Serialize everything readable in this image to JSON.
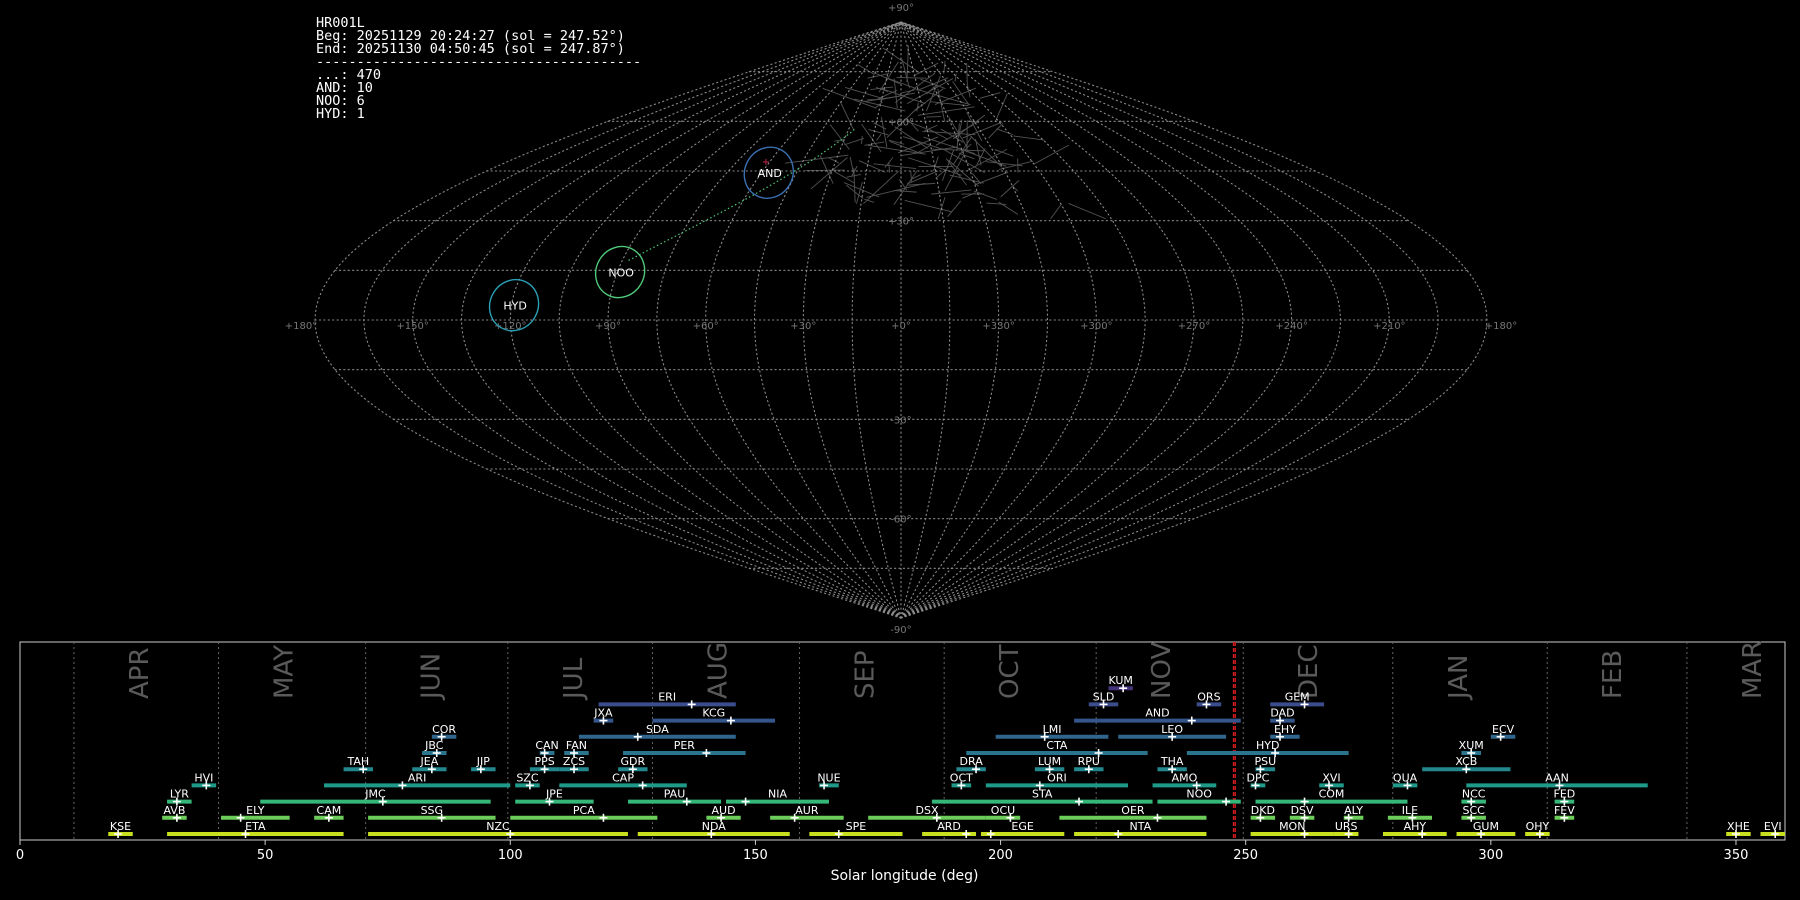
{
  "header": {
    "station": "HR001L",
    "beg": "Beg: 20251129 20:24:27 (sol = 247.52°)",
    "end": "End: 20251130 04:50:45 (sol = 247.87°)",
    "separator": "----------------------------------------",
    "counts": [
      {
        "label": "...: 470"
      },
      {
        "label": "AND: 10"
      },
      {
        "label": "NOO: 6"
      },
      {
        "label": "HYD: 1"
      }
    ]
  },
  "sky_map": {
    "projection": "sinusoidal",
    "lon_labels": [
      "+180°",
      "+150°",
      "+120°",
      "+90°",
      "+60°",
      "+30°",
      "+0°",
      "+330°",
      "+300°",
      "+270°",
      "+240°",
      "+210°",
      "+180°"
    ],
    "lat_labels": [
      "+90°",
      "+60°",
      "+30°",
      "-30°",
      "-60°",
      "-90°"
    ],
    "radiants": [
      {
        "code": "AND",
        "lon": 57,
        "lat": 45,
        "color": "#3b6fb0",
        "r": 6
      },
      {
        "code": "NOO",
        "lon": 89,
        "lat": 15,
        "color": "#4fc97a",
        "r": 6
      },
      {
        "code": "HYD",
        "lon": 119,
        "lat": 5,
        "color": "#2a9fb5",
        "r": 6
      }
    ]
  },
  "chart_data": {
    "type": "timeline",
    "xlabel": "Solar longitude (deg)",
    "xlim": [
      0,
      360
    ],
    "xticks": [
      0,
      50,
      100,
      150,
      200,
      250,
      300,
      350
    ],
    "current_sol": [
      247.52,
      247.87
    ],
    "months": [
      {
        "name": "APR",
        "start": 11
      },
      {
        "name": "MAY",
        "start": 40.5
      },
      {
        "name": "JUN",
        "start": 70.5
      },
      {
        "name": "JUL",
        "start": 99.5
      },
      {
        "name": "AUG",
        "start": 129
      },
      {
        "name": "SEP",
        "start": 159
      },
      {
        "name": "OCT",
        "start": 188.5
      },
      {
        "name": "NOV",
        "start": 219.5
      },
      {
        "name": "DEC",
        "start": 249.5
      },
      {
        "name": "JAN",
        "start": 280
      },
      {
        "name": "FEB",
        "start": 311.5
      },
      {
        "name": "MAR",
        "start": 340
      }
    ],
    "showers": [
      {
        "code": "KUM",
        "row": 8,
        "start": 222,
        "end": 227,
        "peak": 225,
        "color": "#44337a"
      },
      {
        "code": "ERI",
        "row": 7,
        "start": 118,
        "end": 146,
        "peak": 137,
        "color": "#3b4d8c"
      },
      {
        "code": "SLD",
        "row": 7,
        "start": 218,
        "end": 224,
        "peak": 221,
        "color": "#3b4d8c"
      },
      {
        "code": "ORS",
        "row": 7,
        "start": 240,
        "end": 245,
        "peak": 242,
        "color": "#3b4d8c"
      },
      {
        "code": "GEM",
        "row": 7,
        "start": 255,
        "end": 266,
        "peak": 262,
        "color": "#3b4d8c"
      },
      {
        "code": "JXA",
        "row": 6,
        "start": 117,
        "end": 121,
        "peak": 119,
        "color": "#34568c"
      },
      {
        "code": "KCG",
        "row": 6,
        "start": 129,
        "end": 154,
        "peak": 145,
        "color": "#34568c"
      },
      {
        "code": "AND",
        "row": 6,
        "start": 215,
        "end": 249,
        "peak": 239,
        "color": "#34568c"
      },
      {
        "code": "DAD",
        "row": 6,
        "start": 255,
        "end": 260,
        "peak": 257,
        "color": "#34568c"
      },
      {
        "code": "COR",
        "row": 5,
        "start": 84,
        "end": 89,
        "peak": 86,
        "color": "#30658c"
      },
      {
        "code": "SDA",
        "row": 5,
        "start": 114,
        "end": 146,
        "peak": 126,
        "color": "#30658c"
      },
      {
        "code": "LMI",
        "row": 5,
        "start": 199,
        "end": 222,
        "peak": 209,
        "color": "#30658c"
      },
      {
        "code": "LEO",
        "row": 5,
        "start": 224,
        "end": 246,
        "peak": 235,
        "color": "#30658c"
      },
      {
        "code": "EHY",
        "row": 5,
        "start": 255,
        "end": 261,
        "peak": 257,
        "color": "#30658c"
      },
      {
        "code": "ECV",
        "row": 5,
        "start": 300,
        "end": 305,
        "peak": 302,
        "color": "#30658c"
      },
      {
        "code": "JBC",
        "row": 4,
        "start": 82,
        "end": 87,
        "peak": 85,
        "color": "#2b748e"
      },
      {
        "code": "CAN",
        "row": 4,
        "start": 106,
        "end": 109,
        "peak": 107,
        "color": "#2b748e"
      },
      {
        "code": "FAN",
        "row": 4,
        "start": 111,
        "end": 116,
        "peak": 113,
        "color": "#2b748e"
      },
      {
        "code": "PER",
        "row": 4,
        "start": 123,
        "end": 148,
        "peak": 140,
        "color": "#2b748e"
      },
      {
        "code": "CTA",
        "row": 4,
        "start": 193,
        "end": 230,
        "peak": 220,
        "color": "#2b748e"
      },
      {
        "code": "HYD",
        "row": 4,
        "start": 238,
        "end": 271,
        "peak": 256,
        "color": "#2b748e"
      },
      {
        "code": "XUM",
        "row": 4,
        "start": 294,
        "end": 298,
        "peak": 296,
        "color": "#2b748e"
      },
      {
        "code": "TAH",
        "row": 3,
        "start": 66,
        "end": 72,
        "peak": 70,
        "color": "#24878e"
      },
      {
        "code": "JEA",
        "row": 3,
        "start": 80,
        "end": 87,
        "peak": 84,
        "color": "#24878e"
      },
      {
        "code": "JIP",
        "row": 3,
        "start": 92,
        "end": 97,
        "peak": 94,
        "color": "#24878e"
      },
      {
        "code": "PPS",
        "row": 3,
        "start": 104,
        "end": 110,
        "peak": 107,
        "color": "#24878e"
      },
      {
        "code": "ZCS",
        "row": 3,
        "start": 110,
        "end": 116,
        "peak": 113,
        "color": "#24878e"
      },
      {
        "code": "GDR",
        "row": 3,
        "start": 122,
        "end": 128,
        "peak": 125,
        "color": "#24878e"
      },
      {
        "code": "DRA",
        "row": 3,
        "start": 191,
        "end": 197,
        "peak": 195,
        "color": "#24878e"
      },
      {
        "code": "LUM",
        "row": 3,
        "start": 207,
        "end": 213,
        "peak": 210,
        "color": "#24878e"
      },
      {
        "code": "RPU",
        "row": 3,
        "start": 215,
        "end": 221,
        "peak": 218,
        "color": "#24878e"
      },
      {
        "code": "THA",
        "row": 3,
        "start": 232,
        "end": 238,
        "peak": 235,
        "color": "#24878e"
      },
      {
        "code": "PSU",
        "row": 3,
        "start": 252,
        "end": 256,
        "peak": 253,
        "color": "#24878e"
      },
      {
        "code": "XCB",
        "row": 3,
        "start": 286,
        "end": 304,
        "peak": 295,
        "color": "#24878e"
      },
      {
        "code": "HVI",
        "row": 2,
        "start": 35,
        "end": 40,
        "peak": 38,
        "color": "#1f9a8a"
      },
      {
        "code": "ARI",
        "row": 2,
        "start": 62,
        "end": 100,
        "peak": 78,
        "color": "#1f9a8a"
      },
      {
        "code": "SZC",
        "row": 2,
        "start": 101,
        "end": 106,
        "peak": 104,
        "color": "#1f9a8a"
      },
      {
        "code": "CAP",
        "row": 2,
        "start": 110,
        "end": 136,
        "peak": 127,
        "color": "#1f9a8a"
      },
      {
        "code": "NUE",
        "row": 2,
        "start": 163,
        "end": 167,
        "peak": 164,
        "color": "#1f9a8a"
      },
      {
        "code": "OCT",
        "row": 2,
        "start": 190,
        "end": 194,
        "peak": 192,
        "color": "#1f9a8a"
      },
      {
        "code": "ORI",
        "row": 2,
        "start": 197,
        "end": 226,
        "peak": 208,
        "color": "#1f9a8a"
      },
      {
        "code": "AMO",
        "row": 2,
        "start": 231,
        "end": 244,
        "peak": 240,
        "color": "#1f9a8a"
      },
      {
        "code": "DPC",
        "row": 2,
        "start": 251,
        "end": 254,
        "peak": 252,
        "color": "#1f9a8a"
      },
      {
        "code": "XVI",
        "row": 2,
        "start": 265,
        "end": 270,
        "peak": 267,
        "color": "#1f9a8a"
      },
      {
        "code": "QUA",
        "row": 2,
        "start": 280,
        "end": 285,
        "peak": 283,
        "color": "#1f9a8a"
      },
      {
        "code": "AAN",
        "row": 2,
        "start": 295,
        "end": 332,
        "peak": 314,
        "color": "#1f9a8a"
      },
      {
        "code": "LYR",
        "row": 1,
        "start": 30,
        "end": 35,
        "peak": 32,
        "color": "#35b779"
      },
      {
        "code": "JMC",
        "row": 1,
        "start": 49,
        "end": 96,
        "peak": 74,
        "color": "#35b779"
      },
      {
        "code": "JPE",
        "row": 1,
        "start": 101,
        "end": 117,
        "peak": 108,
        "color": "#35b779"
      },
      {
        "code": "PAU",
        "row": 1,
        "start": 124,
        "end": 143,
        "peak": 136,
        "color": "#35b779"
      },
      {
        "code": "NIA",
        "row": 1,
        "start": 144,
        "end": 165,
        "peak": 148,
        "color": "#35b779"
      },
      {
        "code": "STA",
        "row": 1,
        "start": 186,
        "end": 231,
        "peak": 216,
        "color": "#35b779"
      },
      {
        "code": "NOO",
        "row": 1,
        "start": 232,
        "end": 249,
        "peak": 246,
        "color": "#35b779"
      },
      {
        "code": "COM",
        "row": 1,
        "start": 252,
        "end": 283,
        "peak": 262,
        "color": "#35b779"
      },
      {
        "code": "NCC",
        "row": 1,
        "start": 294,
        "end": 299,
        "peak": 296,
        "color": "#35b779"
      },
      {
        "code": "FED",
        "row": 1,
        "start": 313,
        "end": 317,
        "peak": 315,
        "color": "#35b779"
      },
      {
        "code": "AVB",
        "row": 0,
        "start": 29,
        "end": 34,
        "peak": 32,
        "color": "#6ccd5a"
      },
      {
        "code": "ELY",
        "row": 0,
        "start": 41,
        "end": 55,
        "peak": 45,
        "color": "#6ccd5a"
      },
      {
        "code": "CAM",
        "row": 0,
        "start": 60,
        "end": 66,
        "peak": 63,
        "color": "#6ccd5a"
      },
      {
        "code": "SSG",
        "row": 0,
        "start": 71,
        "end": 97,
        "peak": 86,
        "color": "#6ccd5a"
      },
      {
        "code": "PCA",
        "row": 0,
        "start": 100,
        "end": 130,
        "peak": 119,
        "color": "#6ccd5a"
      },
      {
        "code": "AUD",
        "row": 0,
        "start": 140,
        "end": 147,
        "peak": 143,
        "color": "#6ccd5a"
      },
      {
        "code": "AUR",
        "row": 0,
        "start": 153,
        "end": 168,
        "peak": 158,
        "color": "#6ccd5a"
      },
      {
        "code": "DSX",
        "row": 0,
        "start": 173,
        "end": 197,
        "peak": 187,
        "color": "#6ccd5a"
      },
      {
        "code": "OCU",
        "row": 0,
        "start": 197,
        "end": 204,
        "peak": 202,
        "color": "#6ccd5a"
      },
      {
        "code": "OER",
        "row": 0,
        "start": 212,
        "end": 242,
        "peak": 232,
        "color": "#6ccd5a"
      },
      {
        "code": "DKD",
        "row": 0,
        "start": 251,
        "end": 256,
        "peak": 253,
        "color": "#6ccd5a"
      },
      {
        "code": "DSV",
        "row": 0,
        "start": 259,
        "end": 264,
        "peak": 262,
        "color": "#6ccd5a"
      },
      {
        "code": "ALY",
        "row": 0,
        "start": 270,
        "end": 274,
        "peak": 271,
        "color": "#6ccd5a"
      },
      {
        "code": "ILE",
        "row": 0,
        "start": 279,
        "end": 288,
        "peak": 284,
        "color": "#6ccd5a"
      },
      {
        "code": "SCC",
        "row": 0,
        "start": 294,
        "end": 299,
        "peak": 296,
        "color": "#6ccd5a"
      },
      {
        "code": "FEV",
        "row": 0,
        "start": 313,
        "end": 317,
        "peak": 315,
        "color": "#6ccd5a"
      },
      {
        "code": "KSE",
        "row": -1,
        "start": 18,
        "end": 23,
        "peak": 20,
        "color": "#c8e020"
      },
      {
        "code": "ETA",
        "row": -1,
        "start": 30,
        "end": 66,
        "peak": 46,
        "color": "#c8e020"
      },
      {
        "code": "NZC",
        "row": -1,
        "start": 71,
        "end": 124,
        "peak": 100,
        "color": "#c8e020"
      },
      {
        "code": "NDA",
        "row": -1,
        "start": 126,
        "end": 157,
        "peak": 141,
        "color": "#c8e020"
      },
      {
        "code": "SPE",
        "row": -1,
        "start": 161,
        "end": 180,
        "peak": 167,
        "color": "#c8e020"
      },
      {
        "code": "ARD",
        "row": -1,
        "start": 184,
        "end": 195,
        "peak": 193,
        "color": "#c8e020"
      },
      {
        "code": "EGE",
        "row": -1,
        "start": 196,
        "end": 213,
        "peak": 198,
        "color": "#c8e020"
      },
      {
        "code": "NTA",
        "row": -1,
        "start": 215,
        "end": 242,
        "peak": 224,
        "color": "#c8e020"
      },
      {
        "code": "MON",
        "row": -1,
        "start": 251,
        "end": 268,
        "peak": 262,
        "color": "#c8e020"
      },
      {
        "code": "URS",
        "row": -1,
        "start": 268,
        "end": 273,
        "peak": 271,
        "color": "#c8e020"
      },
      {
        "code": "AHY",
        "row": -1,
        "start": 278,
        "end": 291,
        "peak": 286,
        "color": "#c8e020"
      },
      {
        "code": "GUM",
        "row": -1,
        "start": 293,
        "end": 305,
        "peak": 298,
        "color": "#c8e020"
      },
      {
        "code": "OHY",
        "row": -1,
        "start": 307,
        "end": 312,
        "peak": 310,
        "color": "#c8e020"
      },
      {
        "code": "XHE",
        "row": -1,
        "start": 348,
        "end": 353,
        "peak": 350,
        "color": "#c8e020"
      },
      {
        "code": "EVI",
        "row": -1,
        "start": 355,
        "end": 360,
        "peak": 358,
        "color": "#c8e020"
      }
    ]
  }
}
